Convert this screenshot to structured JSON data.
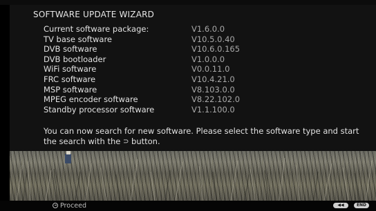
{
  "wizard": {
    "title": "SOFTWARE UPDATE WIZARD",
    "rows": [
      {
        "label": "Current software package:",
        "value": "V1.6.0.0"
      },
      {
        "label": "TV base software",
        "value": "V10.5.0.40"
      },
      {
        "label": "DVB software",
        "value": "V10.6.0.165"
      },
      {
        "label": "DVB bootloader",
        "value": "V1.0.0.0"
      },
      {
        "label": "WiFi software",
        "value": "V0.0.11.0"
      },
      {
        "label": "FRC software",
        "value": "V10.4.21.0"
      },
      {
        "label": "MSP software",
        "value": "V8.103.0.0"
      },
      {
        "label": "MPEG encoder software",
        "value": "V8.22.102.0"
      },
      {
        "label": "Standby processor software",
        "value": "V1.1.100.0"
      }
    ],
    "message_part1": "You can now search for new software. Please select the software type and start the search with the",
    "message_glyph": "⊃",
    "message_part2": "button."
  },
  "footer": {
    "proceed_label": "Proceed",
    "rewind_key_label": "◀◀",
    "end_key_label": "END",
    "proceed_icon": "ok-button-icon"
  },
  "colors": {
    "panel_background": "#121212",
    "text": "#e2e2e2",
    "value_text": "#a9a9a9"
  }
}
